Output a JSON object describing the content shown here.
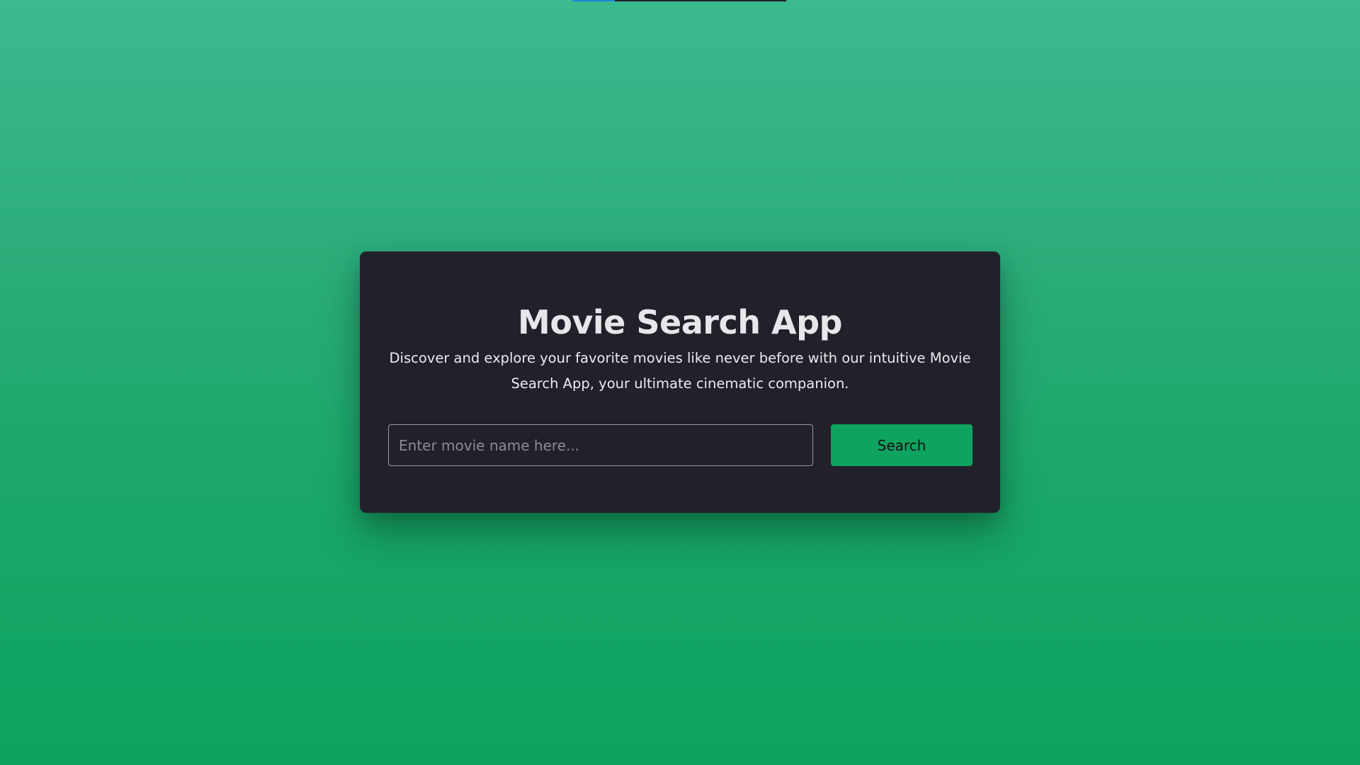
{
  "app": {
    "title": "Movie Search App",
    "description": "Discover and explore your favorite movies like never before with our intuitive Movie Search App, your ultimate cinematic companion."
  },
  "search": {
    "placeholder": "Enter movie name here...",
    "value": "",
    "button_label": "Search"
  },
  "colors": {
    "background_top": "#3bba8f",
    "background_bottom": "#0ea35f",
    "card": "#22202a",
    "accent": "#0ea35f",
    "loader_fill": "#1e86d6"
  }
}
